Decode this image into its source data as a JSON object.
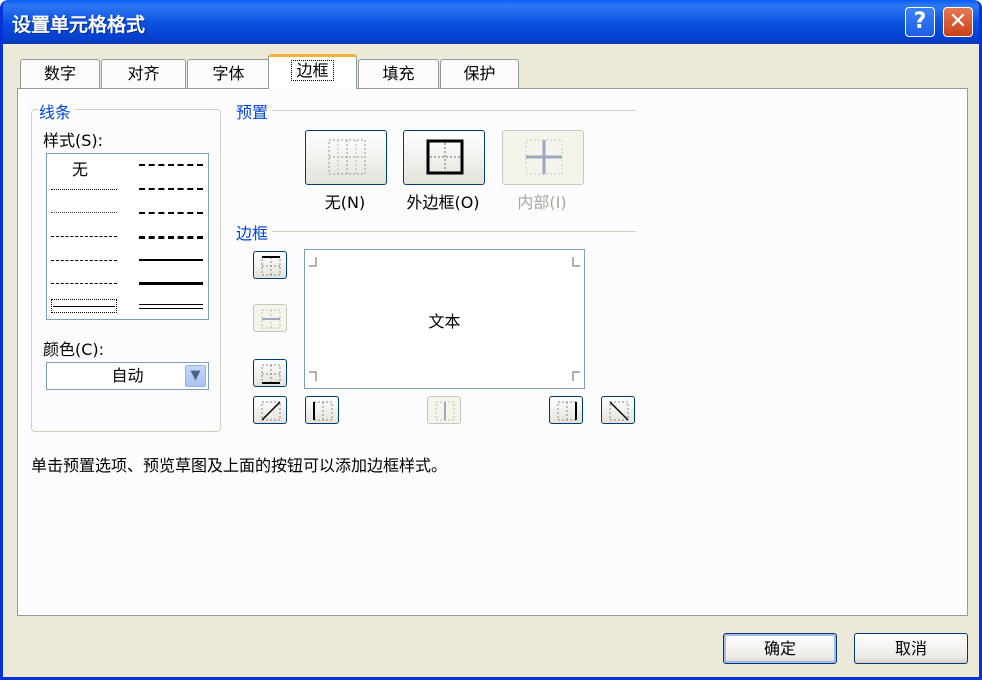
{
  "window": {
    "title": "设置单元格格式",
    "help_label": "?",
    "close_label": "✕"
  },
  "tabs": [
    {
      "label": "数字"
    },
    {
      "label": "对齐"
    },
    {
      "label": "字体"
    },
    {
      "label": "边框",
      "active": true
    },
    {
      "label": "填充"
    },
    {
      "label": "保护"
    }
  ],
  "line": {
    "group_title": "线条",
    "style_label": "样式(S):",
    "none_label": "无",
    "color_label": "颜色(C):",
    "color_value": "自动"
  },
  "presets": {
    "group_title": "预置",
    "items": [
      {
        "label": "无(N)",
        "enabled": true
      },
      {
        "label": "外边框(O)",
        "enabled": true
      },
      {
        "label": "内部(I)",
        "enabled": false
      }
    ]
  },
  "border": {
    "group_title": "边框",
    "preview_text": "文本"
  },
  "hint": "单击预置选项、预览草图及上面的按钮可以添加边框样式。",
  "footer": {
    "ok_label": "确定",
    "cancel_label": "取消"
  },
  "colors": {
    "title_bar": "#0a5cf5",
    "accent": "#0046d5",
    "tab_highlight": "#f3b138"
  }
}
